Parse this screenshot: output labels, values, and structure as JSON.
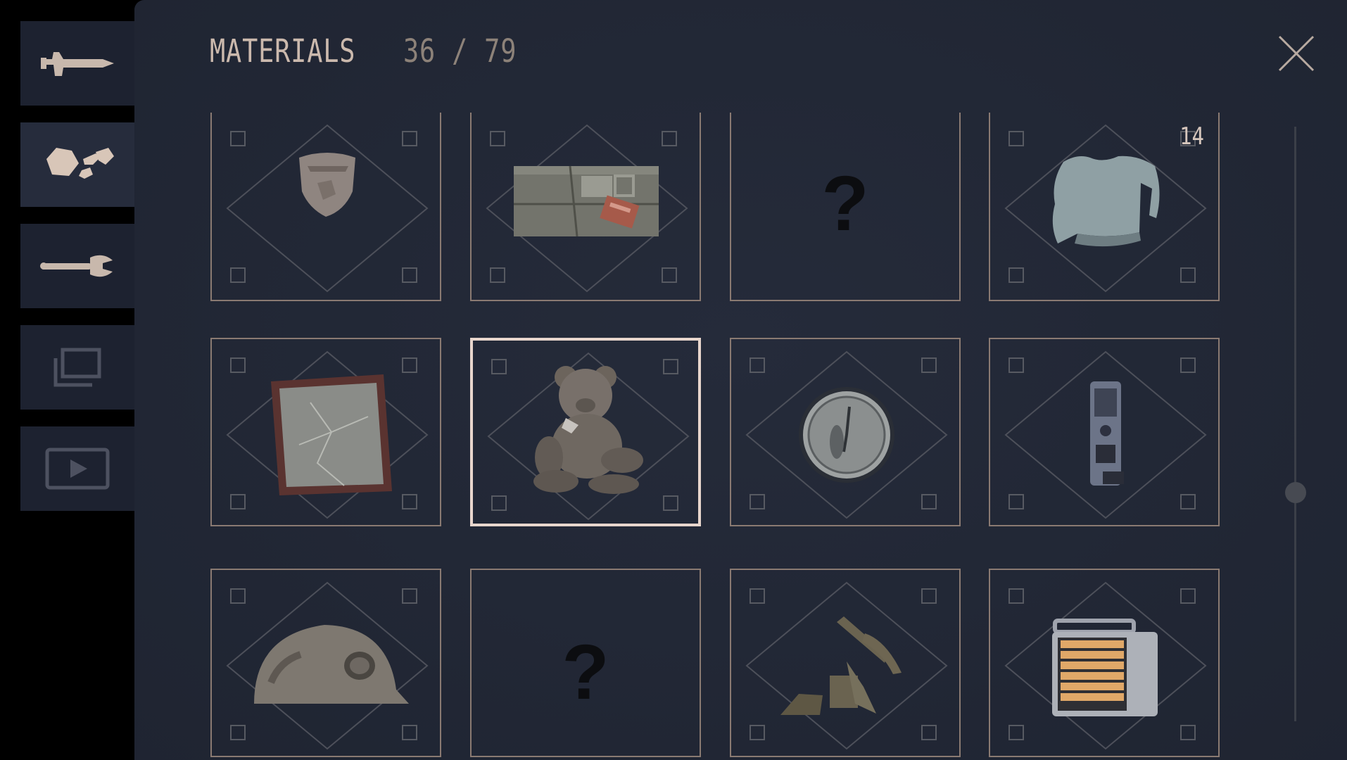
{
  "header": {
    "title": "MATERIALS",
    "count": "36 / 79"
  },
  "sidebar": {
    "tabs": [
      {
        "name": "weapons",
        "icon": "rifle-icon",
        "active": false
      },
      {
        "name": "materials",
        "icon": "rubble-icon",
        "active": true
      },
      {
        "name": "tools",
        "icon": "wrench-icon",
        "active": false
      },
      {
        "name": "gallery",
        "icon": "stacked-frames-icon",
        "active": false
      },
      {
        "name": "videos",
        "icon": "play-icon",
        "active": false
      }
    ]
  },
  "colors": {
    "panel": "#252b3a",
    "sidebar_tab": "#1d2230",
    "accent_text": "#cbb9ad",
    "muted_text": "#8d8279",
    "card_border": "#8a7a72",
    "selected_border": "#e8d6cd"
  },
  "scrollbar": {
    "position": 0.62
  },
  "grid": {
    "items": [
      {
        "icon": "badge-icon",
        "discovered": true,
        "quantity": ""
      },
      {
        "icon": "package-icon",
        "discovered": true,
        "quantity": ""
      },
      {
        "icon": "unknown-icon",
        "discovered": false,
        "label": "?",
        "quantity": ""
      },
      {
        "icon": "sweater-icon",
        "discovered": true,
        "quantity": "14"
      },
      {
        "icon": "broken-frame-icon",
        "discovered": true,
        "quantity": ""
      },
      {
        "icon": "teddy-bear-icon",
        "discovered": true,
        "quantity": "",
        "selected": true
      },
      {
        "icon": "pocket-watch-icon",
        "discovered": true,
        "quantity": ""
      },
      {
        "icon": "voice-recorder-icon",
        "discovered": true,
        "quantity": ""
      },
      {
        "icon": "miner-helmet-icon",
        "discovered": true,
        "quantity": ""
      },
      {
        "icon": "unknown-icon",
        "discovered": false,
        "label": "?",
        "quantity": ""
      },
      {
        "icon": "pickaxe-scrap-icon",
        "discovered": true,
        "quantity": ""
      },
      {
        "icon": "heater-icon",
        "discovered": true,
        "quantity": ""
      }
    ]
  }
}
